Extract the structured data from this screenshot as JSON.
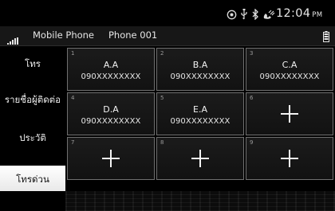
{
  "status_bar": {
    "icons": [
      "location-icon",
      "usb-icon",
      "bluetooth-icon",
      "phone-connected-icon"
    ],
    "time": "12:04",
    "ampm": "PM"
  },
  "phone_bar": {
    "signal_icon": "signal-strength-icon",
    "device_type": "Mobile Phone",
    "device_name": "Phone 001",
    "battery_icon": "battery-icon"
  },
  "sidebar": {
    "items": [
      {
        "label": "โทร",
        "active": false
      },
      {
        "label": "รายชื่อผู้ติดต่อ",
        "active": false
      },
      {
        "label": "ประวัติ",
        "active": false
      },
      {
        "label": "โทรด่วน",
        "active": true
      }
    ]
  },
  "speed_dial": {
    "cells": [
      {
        "num": "1",
        "name": "A.A",
        "number": "090XXXXXXXX"
      },
      {
        "num": "2",
        "name": "B.A",
        "number": "090XXXXXXXX"
      },
      {
        "num": "3",
        "name": "C.A",
        "number": "090XXXXXXXX"
      },
      {
        "num": "4",
        "name": "D.A",
        "number": "090XXXXXXXX"
      },
      {
        "num": "5",
        "name": "E.A",
        "number": "090XXXXXXXX"
      },
      {
        "num": "6",
        "name": "",
        "number": ""
      },
      {
        "num": "7",
        "name": "",
        "number": ""
      },
      {
        "num": "8",
        "name": "",
        "number": ""
      },
      {
        "num": "9",
        "name": "",
        "number": ""
      }
    ]
  },
  "colors": {
    "background": "#000000",
    "cell_border": "#707070",
    "active_tab_bg": "#ffffff",
    "text": "#ffffff"
  }
}
